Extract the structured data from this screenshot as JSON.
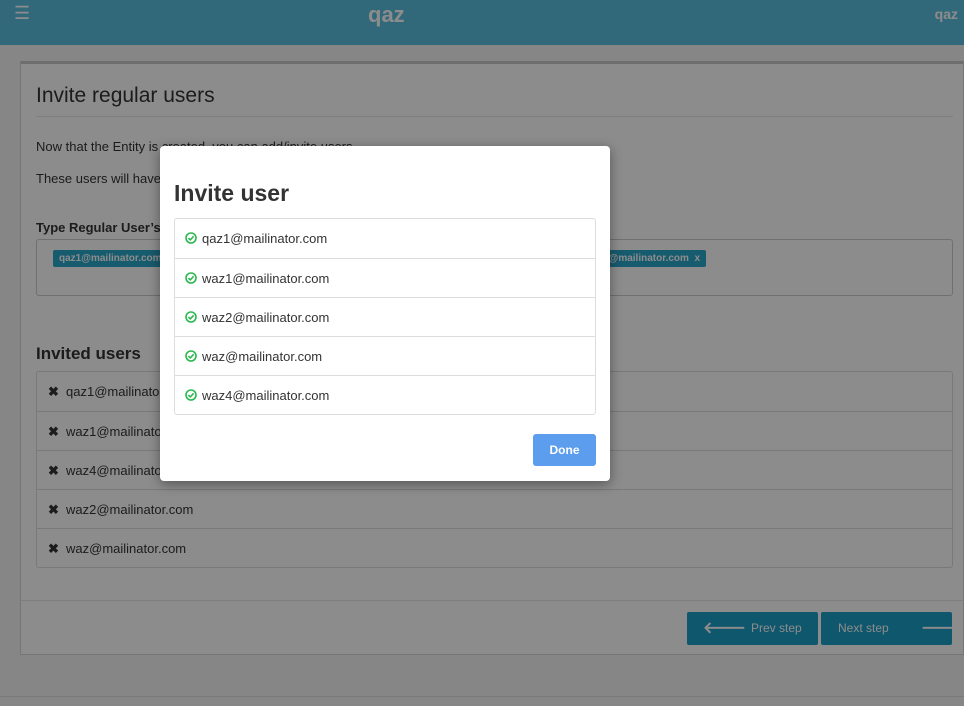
{
  "header": {
    "menu_icon": "☰",
    "title": "qaz",
    "user": "qaz"
  },
  "page": {
    "title": "Invite regular users",
    "para1": "Now that the Entity is created, you can add/invite users.",
    "para2": "These users will have",
    "field_label": "Type Regular User’s E",
    "tags": [
      {
        "label": "qaz1@mailinator.com",
        "remove": ""
      },
      {
        "label": "4@mailinator.com",
        "remove": "x"
      }
    ],
    "invited_title": "Invited users",
    "invited": [
      "qaz1@mailinator.com",
      "waz1@mailinator.com",
      "waz4@mailinator.com",
      "waz2@mailinator.com",
      "waz@mailinator.com"
    ],
    "prev_label": "Prev step",
    "next_label": "Next step",
    "prev_icon": "🡐",
    "next_icon": "🡒"
  },
  "modal": {
    "title": "Invite user",
    "users": [
      "qaz1@mailinator.com",
      "waz1@mailinator.com",
      "waz2@mailinator.com",
      "waz@mailinator.com",
      "waz4@mailinator.com"
    ],
    "done_label": "Done"
  },
  "colors": {
    "topbar": "#5bc0de",
    "primary_button": "#1b9ec6",
    "done_button": "#5c9ded",
    "check": "#2ab94e"
  }
}
